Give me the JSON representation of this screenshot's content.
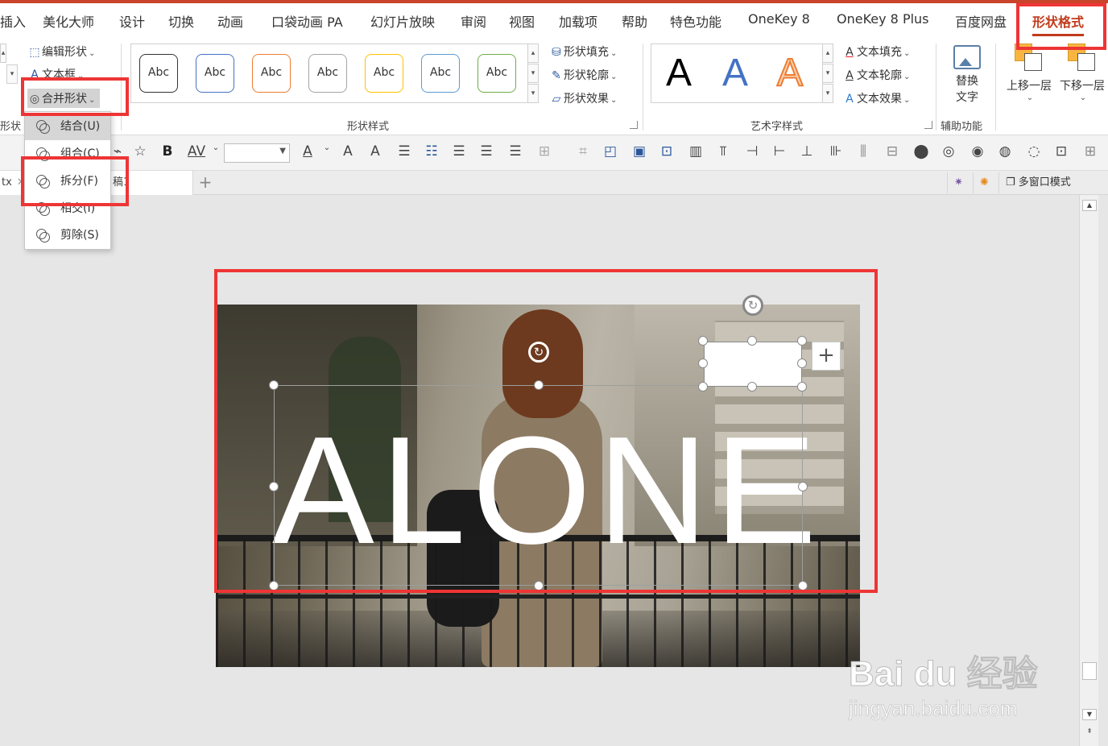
{
  "menubar": {
    "tabs": [
      {
        "label": "插入",
        "shown": "插入"
      },
      {
        "label": "美化大师"
      },
      {
        "label": "设计"
      },
      {
        "label": "切换"
      },
      {
        "label": "动画"
      },
      {
        "label": "口袋动画 PA"
      },
      {
        "label": "幻灯片放映"
      },
      {
        "label": "审阅"
      },
      {
        "label": "视图"
      },
      {
        "label": "加载项"
      },
      {
        "label": "帮助"
      },
      {
        "label": "特色功能"
      },
      {
        "label": "OneKey 8"
      },
      {
        "label": "OneKey 8 Plus"
      },
      {
        "label": "百度网盘"
      },
      {
        "label": "形状格式"
      }
    ],
    "active_tab": "形状格式"
  },
  "ribbon": {
    "insert_shapes": {
      "edit_shape": "编辑形状",
      "text_box": "文本框",
      "merge_shapes": "合并形状",
      "group_label": "形状"
    },
    "shape_styles": {
      "samples": [
        "Abc",
        "Abc",
        "Abc",
        "Abc",
        "Abc",
        "Abc",
        "Abc"
      ],
      "sample_colors": [
        "#333333",
        "#4472c4",
        "#ed7d31",
        "#a5a5a5",
        "#ffc000",
        "#5b9bd5",
        "#70ad47"
      ],
      "fill": "形状填充",
      "outline": "形状轮廓",
      "effects": "形状效果",
      "group_label": "形状样式"
    },
    "wordart": {
      "samples": [
        "A",
        "A",
        "A"
      ],
      "sample_colors": [
        "#000000",
        "#4472c4",
        "#ed7d31"
      ],
      "text_fill": "文本填充",
      "text_outline": "文本轮廓",
      "text_effects": "文本效果",
      "group_label": "艺术字样式"
    },
    "accessibility": {
      "alt_text_line1": "替换",
      "alt_text_line2": "文字",
      "group_label": "辅助功能"
    },
    "arrange": {
      "bring_forward": "上移一层",
      "send_backward": "下移一层"
    }
  },
  "toolbar": {
    "bold": "B",
    "char_spacing": "AV",
    "font_color": "A",
    "grow_font": "A",
    "shrink_font": "A"
  },
  "doctabs": {
    "current_tab": "tx",
    "other_tab": "稿1",
    "multi_window": "多窗口模式"
  },
  "dropdown": {
    "items": [
      {
        "label": "结合(U)",
        "highlighted": true
      },
      {
        "label": "组合(C)"
      },
      {
        "label": "拆分(F)"
      },
      {
        "label": "相交(I)"
      },
      {
        "label": "剪除(S)"
      }
    ]
  },
  "slide": {
    "headline": "ALONE"
  },
  "watermark": {
    "logo": "Bai du 经验",
    "url": "jingyan.baidu.com"
  }
}
